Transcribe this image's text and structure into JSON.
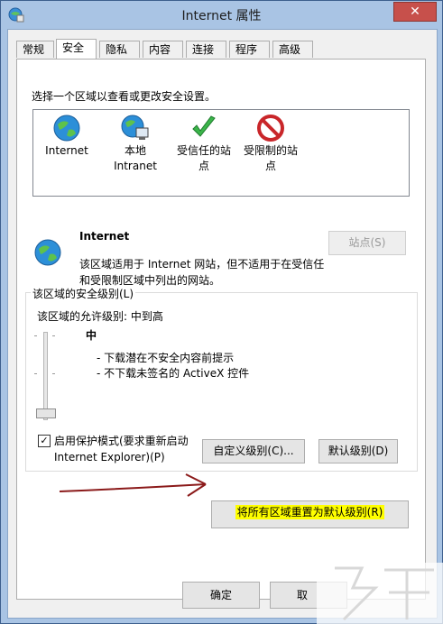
{
  "window": {
    "title": "Internet 属性",
    "close_glyph": "✕"
  },
  "tabs": [
    "常规",
    "安全",
    "隐私",
    "内容",
    "连接",
    "程序",
    "高级"
  ],
  "security": {
    "instruction": "选择一个区域以查看或更改安全设置。",
    "zones": [
      {
        "line1": "Internet",
        "line2": "",
        "icon": "globe-icon"
      },
      {
        "line1": "本地",
        "line2": "Intranet",
        "icon": "local-intranet-icon"
      },
      {
        "line1": "受信任的站",
        "line2": "点",
        "icon": "checkmark-icon"
      },
      {
        "line1": "受限制的站",
        "line2": "点",
        "icon": "restricted-icon"
      }
    ],
    "selected_zone": {
      "name": "Internet",
      "desc_line1": "该区域适用于 Internet 网站，但不适用于在受信任",
      "desc_line2": "和受限制区域中列出的网站。"
    },
    "sites_button": "站点(S)",
    "level_group": {
      "title": "该区域的安全级别(L)",
      "allowed": "该区域的允许级别: 中到高",
      "level_name": "中",
      "bullets": [
        "- 下载潜在不安全内容前提示",
        "- 不下载未签名的 ActiveX 控件"
      ],
      "protected_mode_line1": "启用保护模式(要求重新启动",
      "protected_mode_line2": "Internet Explorer)(P)",
      "protected_mode_checked": "✓",
      "custom_button": "自定义级别(C)...",
      "default_button": "默认级别(D)"
    },
    "reset_all_button": "将所有区域重置为默认级别(R)"
  },
  "footer": {
    "ok": "确定",
    "cancel": "取"
  },
  "colors": {
    "highlight": "#ffff00",
    "arrow": "#8b1a1a",
    "title_bar": "#a9c4e4"
  }
}
